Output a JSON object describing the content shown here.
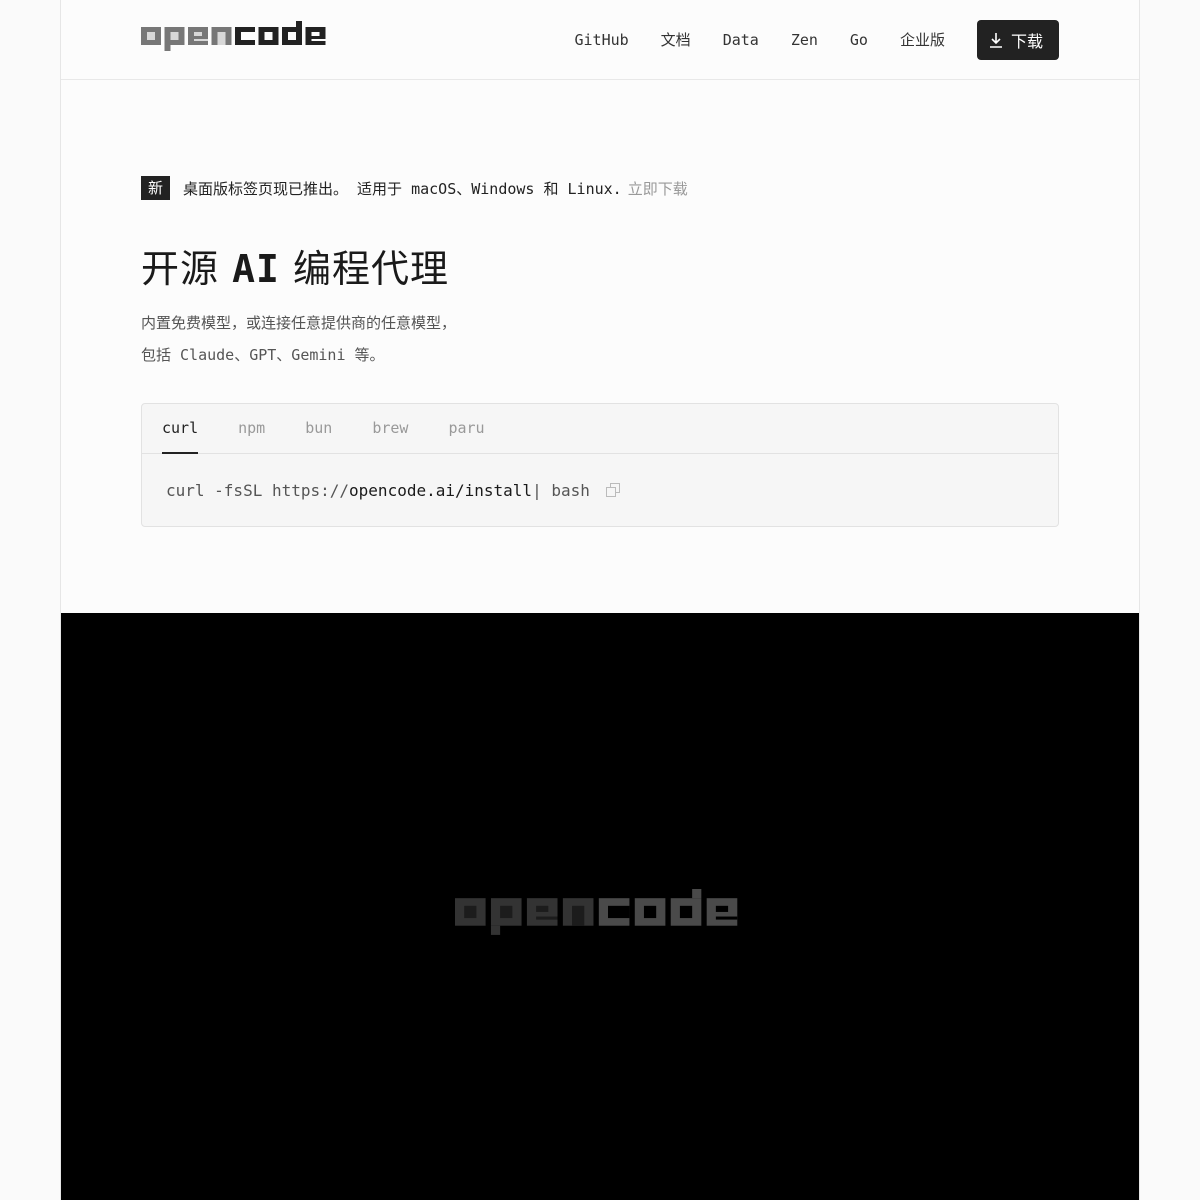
{
  "header": {
    "logo_text": "opencode",
    "nav": [
      "GitHub",
      "文档",
      "Data",
      "Zen",
      "Go",
      "企业版"
    ],
    "download_label": "下载"
  },
  "announcement": {
    "badge": "新",
    "text": "桌面版标签页现已推出。 适用于 macOS、Windows 和 Linux.",
    "link": "立即下载"
  },
  "hero": {
    "title_pre": "开源 ",
    "title_ai": "AI",
    "title_post": " 编程代理",
    "desc_line1": "内置免费模型，或连接任意提供商的任意模型，",
    "desc_line2": "包括 Claude、GPT、Gemini 等。"
  },
  "install": {
    "tabs": [
      "curl",
      "npm",
      "bun",
      "brew",
      "paru"
    ],
    "active_tab": "curl",
    "command_pre": "curl -fsSL https://",
    "command_em": "opencode.ai/install",
    "command_post": " | bash"
  },
  "video": {
    "logo_text": "opencode"
  },
  "colors": {
    "background": "#fcfcfc",
    "text": "#222222",
    "muted": "#999999",
    "button": "#222222",
    "video_bg": "#000000"
  }
}
